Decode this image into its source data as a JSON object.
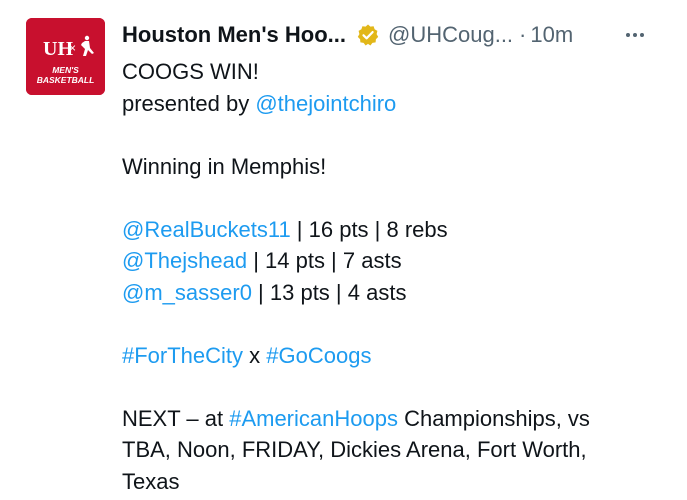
{
  "author": {
    "display_name": "Houston Men's Hoo...",
    "handle": "@UHCoug...",
    "separator": "·",
    "time": "10m",
    "avatar_text": "MEN'S BASKETBALL",
    "avatar_logo": "UH",
    "avatar_x": "×"
  },
  "icons": {
    "verified": "verified-badge-icon",
    "more": "more-options-icon"
  },
  "colors": {
    "link": "#1d9bf0",
    "avatar_bg": "#c8102e",
    "badge": "#e2b719"
  },
  "tweet": {
    "line1": "COOGS WIN!",
    "line2_prefix": "presented by ",
    "line2_mention": "@thejointchiro",
    "line3": "Winning in Memphis!",
    "stats": [
      {
        "mention": "@RealBuckets11",
        "text": " | 16 pts | 8 rebs"
      },
      {
        "mention": "@Thejshead",
        "text": " | 14 pts | 7 asts"
      },
      {
        "mention": "@m_sasser0",
        "text": " | 13 pts | 4 asts"
      }
    ],
    "hashtag1": "#ForTheCity",
    "hashtag_joiner": " x ",
    "hashtag2": "#GoCoogs",
    "next_prefix": "NEXT – at ",
    "next_hashtag": "#AmericanHoops",
    "next_line1_rest": " Championships, vs",
    "next_line2": "TBA, Noon, FRIDAY, Dickies Arena, Fort Worth,",
    "next_line3": "Texas"
  }
}
